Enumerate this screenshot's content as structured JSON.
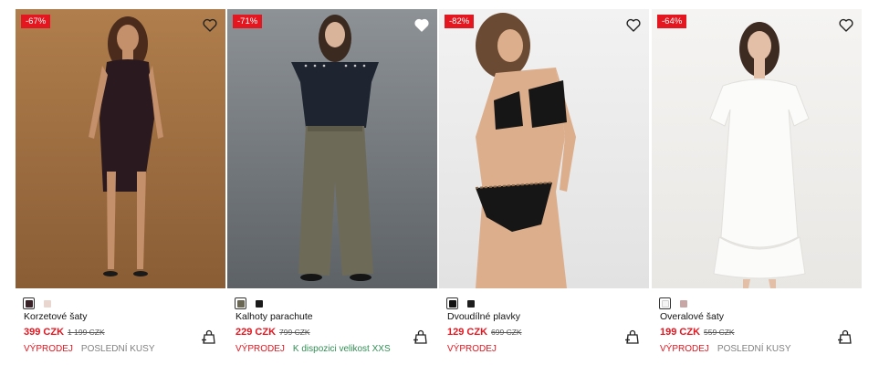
{
  "colors": {
    "accent": "#e4161f",
    "note_green": "#2f8f52",
    "muted": "#808080"
  },
  "products": [
    {
      "badge": "-67%",
      "name": "Korzetové šaty",
      "price": "399 CZK",
      "old_price": "1 199 CZK",
      "sale_label": "VÝPRODEJ",
      "note": "POSLEDNÍ KUSY",
      "swatches": [
        "#3a2328",
        "#e8d6cf"
      ],
      "photo": {
        "bg_top": "#b07e4c",
        "bg_bottom": "#8a5d35",
        "outfit": "#2a1a20",
        "hair": "#4a2b1c",
        "skin": "#c48f6b"
      }
    },
    {
      "badge": "-71%",
      "name": "Kalhoty parachute",
      "price": "229 CZK",
      "old_price": "799 CZK",
      "sale_label": "VÝPRODEJ",
      "note": "K dispozici velikost XXS",
      "swatches": [
        "#6b6755",
        "#1b1b1b"
      ],
      "photo": {
        "bg_top": "#8d9296",
        "bg_bottom": "#5d6266",
        "top": "#1f2530",
        "pants": "#6e6a58",
        "hair": "#3b2a20",
        "skin": "#d9b49a"
      }
    },
    {
      "badge": "-82%",
      "name": "Dvoudílné plavky",
      "price": "129 CZK",
      "old_price": "699 CZK",
      "sale_label": "VÝPRODEJ",
      "note": "",
      "swatches": [
        "#111111",
        "#1e1e1e"
      ],
      "photo": {
        "bg_top": "#f2f2f2",
        "bg_bottom": "#e2e2e2",
        "outfit": "#161616",
        "hair": "#6b4a33",
        "skin": "#dcae8c"
      }
    },
    {
      "badge": "-64%",
      "name": "Overalové šaty",
      "price": "199 CZK",
      "old_price": "559 CZK",
      "sale_label": "VÝPRODEJ",
      "note": "POSLEDNÍ KUSY",
      "swatches": [
        "#f4f4f4",
        "#c9a6a6"
      ],
      "photo": {
        "bg_top": "#f5f4f2",
        "bg_bottom": "#e9e7e4",
        "outfit": "#fbfbfa",
        "hair": "#3d2a21",
        "skin": "#e2bfa6"
      }
    }
  ]
}
